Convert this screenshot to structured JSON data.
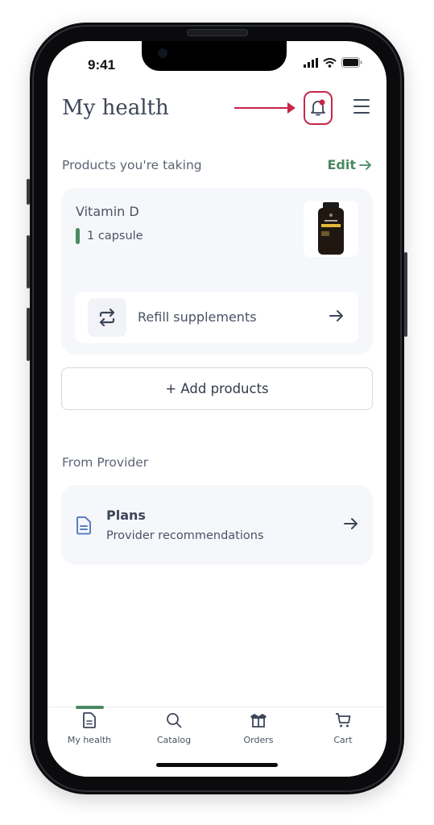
{
  "status_bar": {
    "time": "9:41"
  },
  "header": {
    "title": "My health",
    "notification_badge_color": "#c8264a"
  },
  "products_section": {
    "label": "Products you're taking",
    "edit_label": "Edit",
    "accent_color": "#4a8a62"
  },
  "product": {
    "name": "Vitamin D",
    "dose": "1 capsule"
  },
  "refill": {
    "label": "Refill supplements"
  },
  "add_products": {
    "label": "+ Add products"
  },
  "provider_section": {
    "label": "From Provider",
    "card_title": "Plans",
    "card_subtitle": "Provider recommendations"
  },
  "bottom_nav": {
    "items": [
      {
        "label": "My health",
        "icon": "document-icon",
        "active": true
      },
      {
        "label": "Catalog",
        "icon": "search-icon",
        "active": false
      },
      {
        "label": "Orders",
        "icon": "box-icon",
        "active": false
      },
      {
        "label": "Cart",
        "icon": "cart-icon",
        "active": false
      }
    ]
  }
}
